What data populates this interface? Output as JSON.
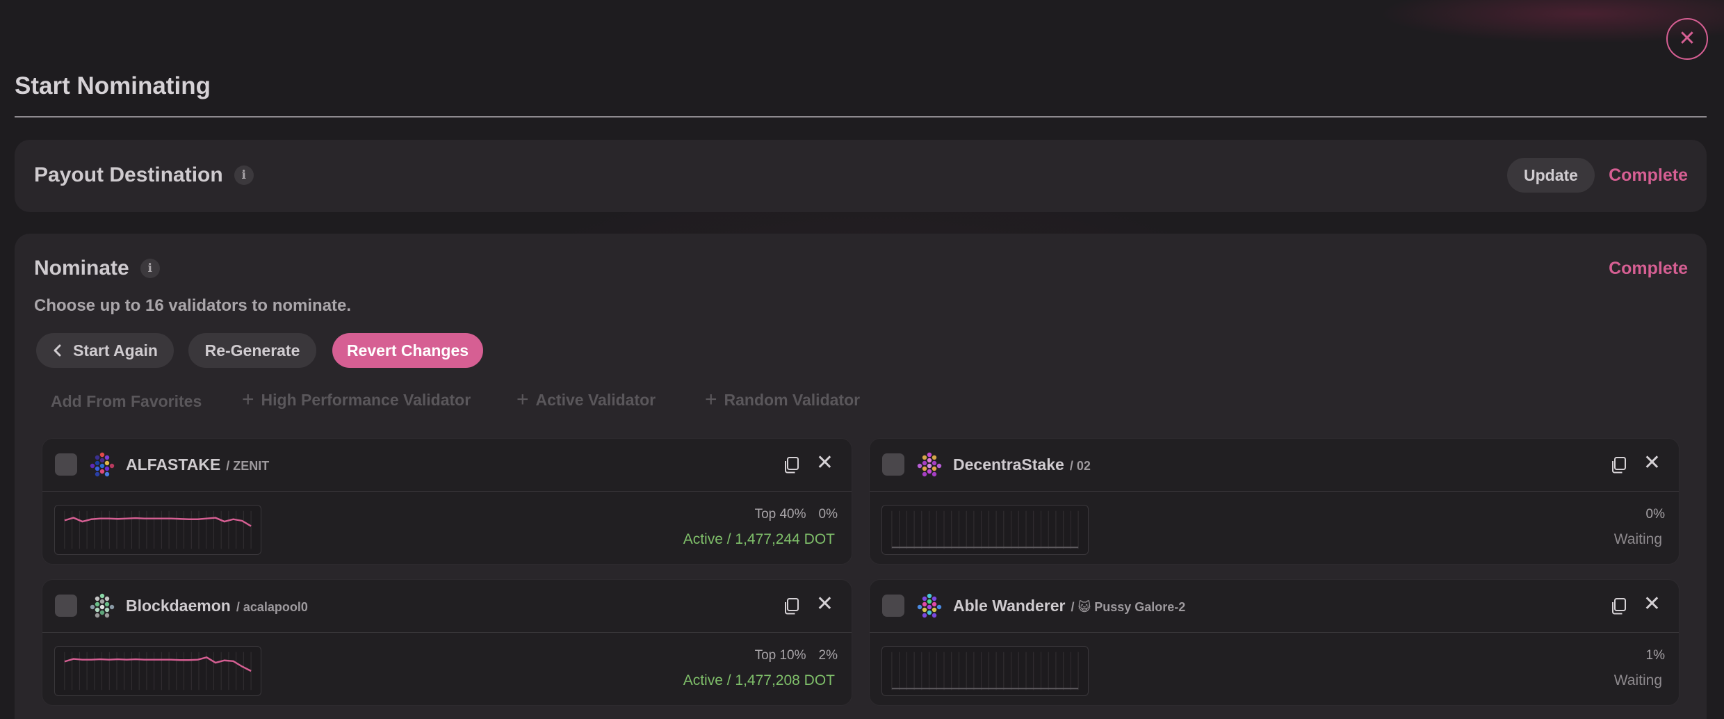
{
  "modal": {
    "title": "Start Nominating",
    "close_label": "✕"
  },
  "payout": {
    "heading": "Payout Destination",
    "update_label": "Update",
    "status": "Complete"
  },
  "nominate": {
    "heading": "Nominate",
    "status": "Complete",
    "subtitle": "Choose up to 16 validators to nominate.",
    "buttons": {
      "start_again": "Start Again",
      "regenerate": "Re-Generate",
      "revert": "Revert Changes"
    },
    "adders": {
      "favorites": "Add From Favorites",
      "high_performance": "High Performance Validator",
      "active": "Active Validator",
      "random": "Random Validator"
    }
  },
  "validators": [
    {
      "name": "ALFASTAKE",
      "sub": "/ ZENIT",
      "rank": "Top 40%",
      "commission": "0%",
      "status": "Active / 1,477,244 DOT",
      "status_type": "active",
      "spark": [
        0.75,
        0.82,
        0.72,
        0.78,
        0.8,
        0.8,
        0.79,
        0.8,
        0.81,
        0.8,
        0.8,
        0.8,
        0.8,
        0.79,
        0.78,
        0.78,
        0.8,
        0.82,
        0.72,
        0.78,
        0.74,
        0.6
      ]
    },
    {
      "name": "DecentraStake",
      "sub": "/ 02",
      "rank": "",
      "commission": "0%",
      "status": "Waiting",
      "status_type": "waiting",
      "spark": []
    },
    {
      "name": "Blockdaemon",
      "sub": "/ acalapool0",
      "rank": "Top 10%",
      "commission": "2%",
      "status": "Active / 1,477,208 DOT",
      "status_type": "active",
      "spark": [
        0.75,
        0.82,
        0.8,
        0.8,
        0.81,
        0.8,
        0.81,
        0.8,
        0.81,
        0.8,
        0.8,
        0.8,
        0.8,
        0.79,
        0.79,
        0.8,
        0.86,
        0.72,
        0.78,
        0.76,
        0.62,
        0.5
      ]
    },
    {
      "name": "Able Wanderer",
      "sub": "/ 😺 Pussy Galore-2",
      "rank": "",
      "commission": "1%",
      "status": "Waiting",
      "status_type": "waiting",
      "spark": []
    }
  ],
  "colors": {
    "accent": "#d65f93",
    "active": "#7fbf6a",
    "waiting": "#8e8a8e"
  },
  "icons": [
    "close-icon",
    "info-icon",
    "chevron-left-icon",
    "plus-icon",
    "copy-icon",
    "remove-icon",
    "identicon"
  ]
}
